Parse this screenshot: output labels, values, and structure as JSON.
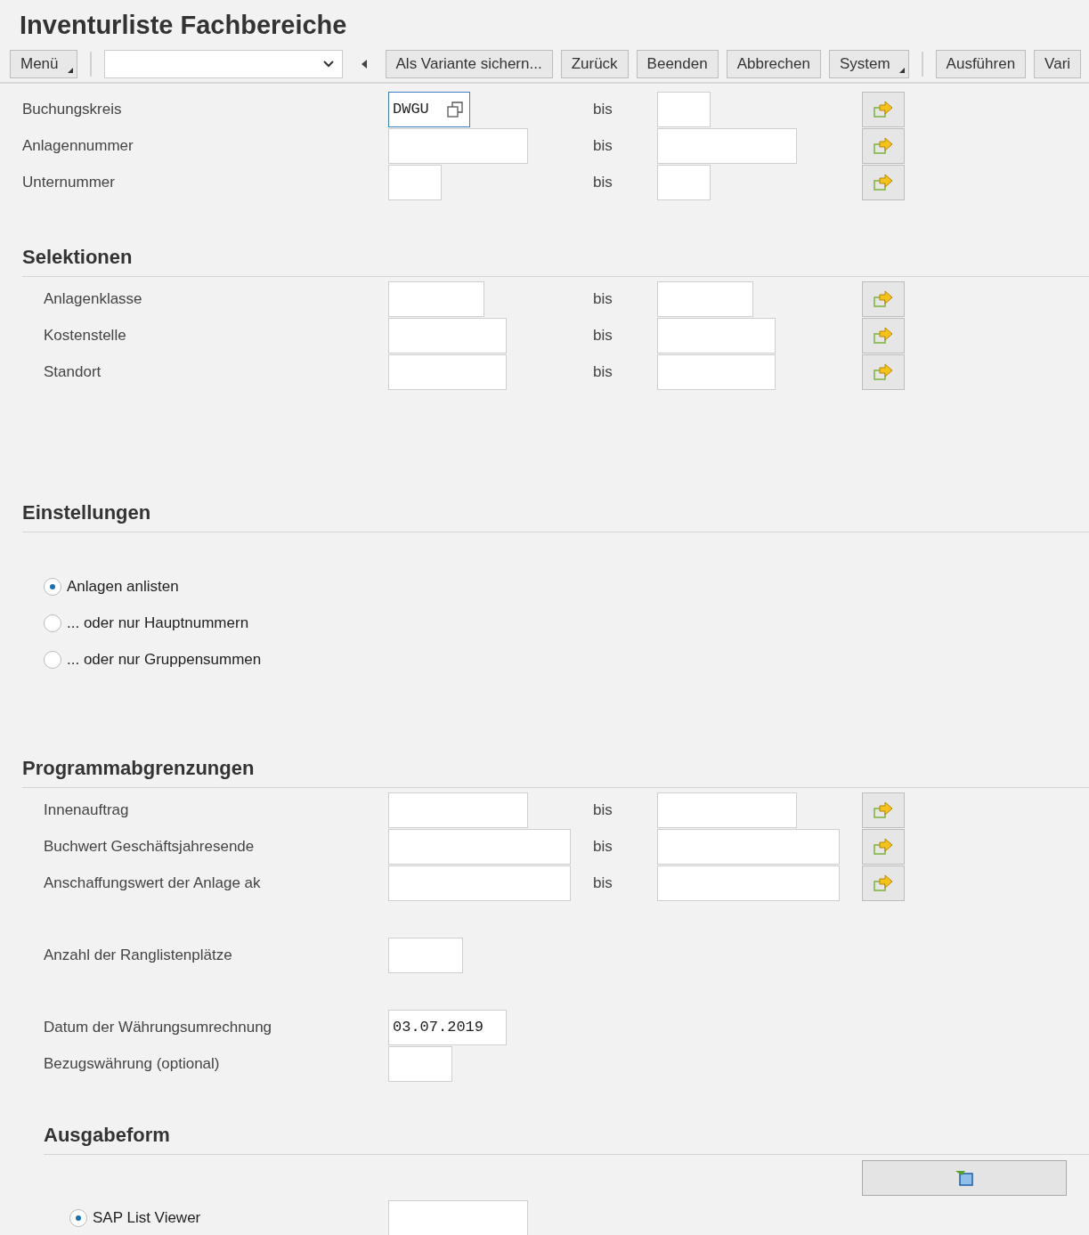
{
  "title": "Inventurliste Fachbereiche",
  "toolbar": {
    "groups": [
      [
        {
          "kind": "menu",
          "label": "Menü"
        }
      ],
      [
        {
          "kind": "dropdown"
        },
        {
          "kind": "nav"
        },
        {
          "kind": "button",
          "label": "Als Variante sichern..."
        },
        {
          "kind": "button",
          "label": "Zurück"
        },
        {
          "kind": "button",
          "label": "Beenden"
        },
        {
          "kind": "button",
          "label": "Abbrechen"
        },
        {
          "kind": "menu",
          "label": "System"
        }
      ],
      [
        {
          "kind": "button",
          "label": "Ausführen"
        },
        {
          "kind": "button",
          "label": "Vari"
        }
      ]
    ]
  },
  "sections": [
    {
      "groups": [
        [
          {
            "kind": "range",
            "label": "Buchungskreis",
            "low": "DWGU",
            "focused": true,
            "bis": "bis"
          },
          {
            "kind": "range",
            "label": "Anlagennummer",
            "focused": false,
            "bis": "bis"
          },
          {
            "kind": "range",
            "label": "Unternummer",
            "focused": false,
            "bis": "bis"
          }
        ]
      ]
    },
    {
      "heading": "Selektionen",
      "groups": [
        [
          {
            "kind": "range",
            "label": "Anlagenklasse",
            "focused": false,
            "bis": "bis"
          },
          {
            "kind": "range",
            "label": "Kostenstelle",
            "focused": false,
            "bis": "bis"
          },
          {
            "kind": "range",
            "label": "Standort",
            "focused": false,
            "bis": "bis"
          }
        ]
      ]
    },
    {
      "heading": "Einstellungen",
      "groups": [
        [
          {
            "kind": "radio",
            "label": "Anlagen anlisten",
            "selected": true
          },
          {
            "kind": "radio",
            "label": "... oder nur Hauptnummern",
            "selected": false
          },
          {
            "kind": "radio",
            "label": "... oder nur Gruppensummen",
            "selected": false
          }
        ]
      ]
    },
    {
      "heading": "Programmabgrenzungen",
      "groups": [
        [
          {
            "kind": "range",
            "label": "Innenauftrag",
            "focused": false,
            "bis": "bis"
          },
          {
            "kind": "range",
            "label": "Buchwert Geschäftsjahresende",
            "focused": false,
            "bis": "bis"
          },
          {
            "kind": "range",
            "label": "Anschaffungswert der Anlage ak",
            "focused": false,
            "bis": "bis"
          }
        ],
        [
          {
            "kind": "single",
            "label": "Anzahl der Ranglistenplätze"
          }
        ],
        [
          {
            "kind": "single",
            "label": "Datum der Währungsumrechnung",
            "value": "03.07.2019"
          },
          {
            "kind": "single",
            "label": "Bezugswährung (optional)"
          }
        ]
      ]
    },
    {
      "heading": "Ausgabeform",
      "groups": [
        [
          {
            "kind": "layout"
          },
          {
            "kind": "radio-field",
            "label": "SAP List Viewer",
            "selected": true
          }
        ]
      ]
    }
  ]
}
